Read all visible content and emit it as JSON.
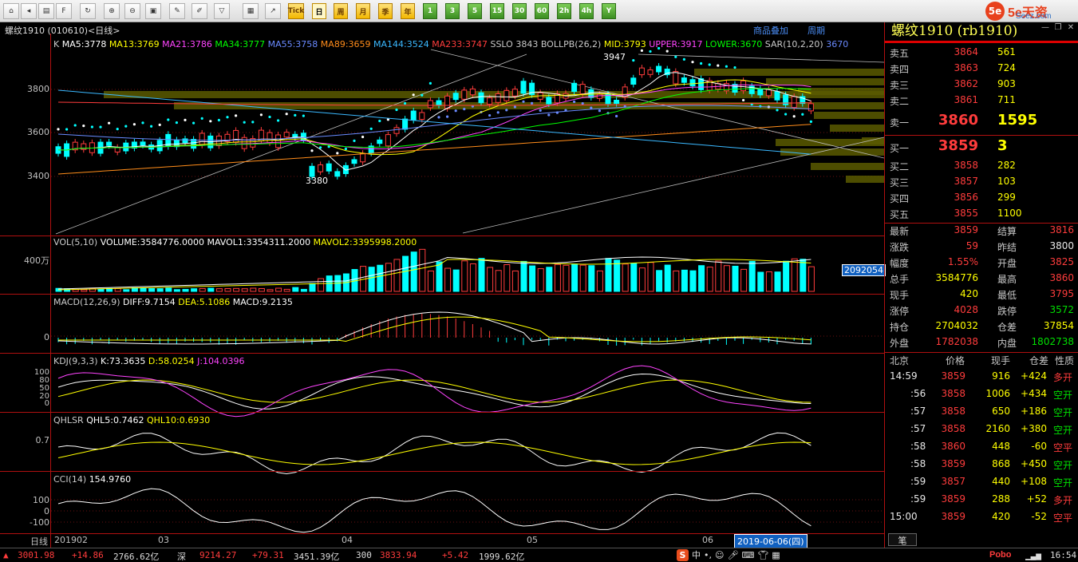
{
  "toolbar": {
    "periods": [
      "Tick",
      "日",
      "周",
      "月",
      "季",
      "年",
      "1",
      "3",
      "5",
      "15",
      "30",
      "60",
      "2h",
      "4h",
      "Y"
    ],
    "active_period": "日"
  },
  "brand": {
    "logo": "5e",
    "name": "5e天资",
    "sub": "Seez.com"
  },
  "chart": {
    "header_title": "螺纹1910 (010610)<日线>",
    "header_right_1": "商品叠加",
    "header_right_2": "周期",
    "main_label_k": "K",
    "ma": [
      {
        "text": "MA5:3778",
        "color": "#ffffff"
      },
      {
        "text": "MA13:3769",
        "color": "#ffff00"
      },
      {
        "text": "MA21:3786",
        "color": "#ff44ff"
      },
      {
        "text": "MA34:3777",
        "color": "#00ff00"
      },
      {
        "text": "MA55:3758",
        "color": "#6a8aff"
      },
      {
        "text": "MA89:3659",
        "color": "#ff8c1a"
      },
      {
        "text": "MA144:3524",
        "color": "#3ab8ff"
      },
      {
        "text": "MA233:3747",
        "color": "#ff3c3c"
      },
      {
        "text": "SSLO 3843",
        "color": "#c8c8c8"
      },
      {
        "text": "BOLLPB(26,2)",
        "color": "#c8c8c8"
      },
      {
        "text": "MID:3793",
        "color": "#ffff00"
      },
      {
        "text": "UPPER:3917",
        "color": "#ff44ff"
      },
      {
        "text": "LOWER:3670",
        "color": "#00ff00"
      },
      {
        "text": "SAR(10,2,20)",
        "color": "#c8c8c8"
      },
      {
        "text": "3670",
        "color": "#6a8aff"
      }
    ],
    "price_axis": [
      "3800",
      "3600",
      "3400"
    ],
    "high_label": "3947",
    "low_label": "3380",
    "vol_label": "VOL(5,10)",
    "vol_volume": "VOLUME:3584776.0000",
    "vol_mavol1": "MAVOL1:3354311.2000",
    "vol_mavol2": "MAVOL2:3395998.2000",
    "vol_axis": "400万",
    "vol_current": "2092054",
    "macd_label": "MACD(12,26,9)",
    "macd_diff": "DIFF:9.7154",
    "macd_dea": "DEA:5.1086",
    "macd_val": "MACD:9.2135",
    "macd_axis": "0",
    "kdj_label": "KDJ(9,3,3)",
    "kdj_k": "K:73.3635",
    "kdj_d": "D:58.0254",
    "kdj_j": "J:104.0396",
    "kdj_axis": [
      "100",
      "80",
      "50",
      "20",
      "0"
    ],
    "qhlsr_label": "QHLSR",
    "qhlsr_5": "QHL5:0.7462",
    "qhlsr_10": "QHL10:0.6930",
    "qhlsr_axis": "0.7",
    "cci_label": "CCI(14)",
    "cci_val": "154.9760",
    "cci_axis": [
      "100",
      "0",
      "-100"
    ],
    "xaxis_label": "日线",
    "x_labels": [
      "201902",
      "03",
      "04",
      "05",
      "06"
    ],
    "date_box": "2019-06-06(四)"
  },
  "quote": {
    "title": "螺纹1910 (rb1910)",
    "asks": [
      {
        "label": "卖五",
        "price": "3864",
        "vol": "561"
      },
      {
        "label": "卖四",
        "price": "3863",
        "vol": "724"
      },
      {
        "label": "卖三",
        "price": "3862",
        "vol": "903"
      },
      {
        "label": "卖二",
        "price": "3861",
        "vol": "711"
      }
    ],
    "ask1": {
      "label": "卖一",
      "price": "3860",
      "vol": "1595"
    },
    "bid1": {
      "label": "买一",
      "price": "3859",
      "vol": "3"
    },
    "bids": [
      {
        "label": "买二",
        "price": "3858",
        "vol": "282"
      },
      {
        "label": "买三",
        "price": "3857",
        "vol": "103"
      },
      {
        "label": "买四",
        "price": "3856",
        "vol": "299"
      },
      {
        "label": "买五",
        "price": "3855",
        "vol": "1100"
      }
    ],
    "stats": [
      {
        "l1": "最新",
        "v1": "3859",
        "c1": "red",
        "l2": "结算",
        "v2": "3816",
        "c2": "red"
      },
      {
        "l1": "涨跌",
        "v1": "59",
        "c1": "red",
        "l2": "昨结",
        "v2": "3800",
        "c2": "white"
      },
      {
        "l1": "幅度",
        "v1": "1.55%",
        "c1": "red",
        "l2": "开盘",
        "v2": "3825",
        "c2": "red"
      },
      {
        "l1": "总手",
        "v1": "3584776",
        "c1": "yellow",
        "l2": "最高",
        "v2": "3860",
        "c2": "red"
      },
      {
        "l1": "现手",
        "v1": "420",
        "c1": "yellow",
        "l2": "最低",
        "v2": "3795",
        "c2": "red"
      },
      {
        "l1": "涨停",
        "v1": "4028",
        "c1": "red",
        "l2": "跌停",
        "v2": "3572",
        "c2": "green"
      },
      {
        "l1": "持仓",
        "v1": "2704032",
        "c1": "yellow",
        "l2": "仓差",
        "v2": "37854",
        "c2": "yellow"
      },
      {
        "l1": "外盘",
        "v1": "1782038",
        "c1": "red",
        "l2": "内盘",
        "v2": "1802738",
        "c2": "green"
      }
    ],
    "tick_header": {
      "c0": "北京",
      "c1": "价格",
      "c2": "现手",
      "c3": "仓差",
      "c4": "性质"
    },
    "ticks": [
      {
        "t": "14:59",
        "p": "3859",
        "v": "916",
        "d": "+424",
        "n": "多开",
        "nc": "red"
      },
      {
        "t": ":56",
        "p": "3858",
        "v": "1006",
        "d": "+434",
        "n": "空开",
        "nc": "green"
      },
      {
        "t": ":57",
        "p": "3858",
        "v": "650",
        "d": "+186",
        "n": "空开",
        "nc": "green"
      },
      {
        "t": ":57",
        "p": "3858",
        "v": "2160",
        "d": "+380",
        "n": "空开",
        "nc": "green"
      },
      {
        "t": ":58",
        "p": "3860",
        "v": "448",
        "d": "-60",
        "n": "空平",
        "nc": "red"
      },
      {
        "t": ":58",
        "p": "3859",
        "v": "868",
        "d": "+450",
        "n": "空开",
        "nc": "green"
      },
      {
        "t": ":59",
        "p": "3857",
        "v": "440",
        "d": "+108",
        "n": "空开",
        "nc": "green"
      },
      {
        "t": ":59",
        "p": "3859",
        "v": "288",
        "d": "+52",
        "n": "多开",
        "nc": "red"
      },
      {
        "t": "15:00",
        "p": "3859",
        "v": "420",
        "d": "-52",
        "n": "空平",
        "nc": "red"
      }
    ],
    "tab_label": "笔"
  },
  "status": {
    "sh": "3001.98",
    "sh_chg": "+14.86",
    "sh_amt": "2766.62亿",
    "sz_label": "深",
    "sz": "9214.27",
    "sz_chg": "+79.31",
    "sz_amt": "3451.39亿",
    "i300_label": "300",
    "i300": "3833.94",
    "i300_chg": "+5.42",
    "i300_amt": "1999.62亿",
    "ime_lang": "中",
    "app_name": "Pobo",
    "clock": "16:54"
  },
  "colors": {
    "up": "#ff3c3c",
    "down": "#00ffff",
    "grid_red": "#b01010",
    "accent_yellow": "#ffff00"
  }
}
